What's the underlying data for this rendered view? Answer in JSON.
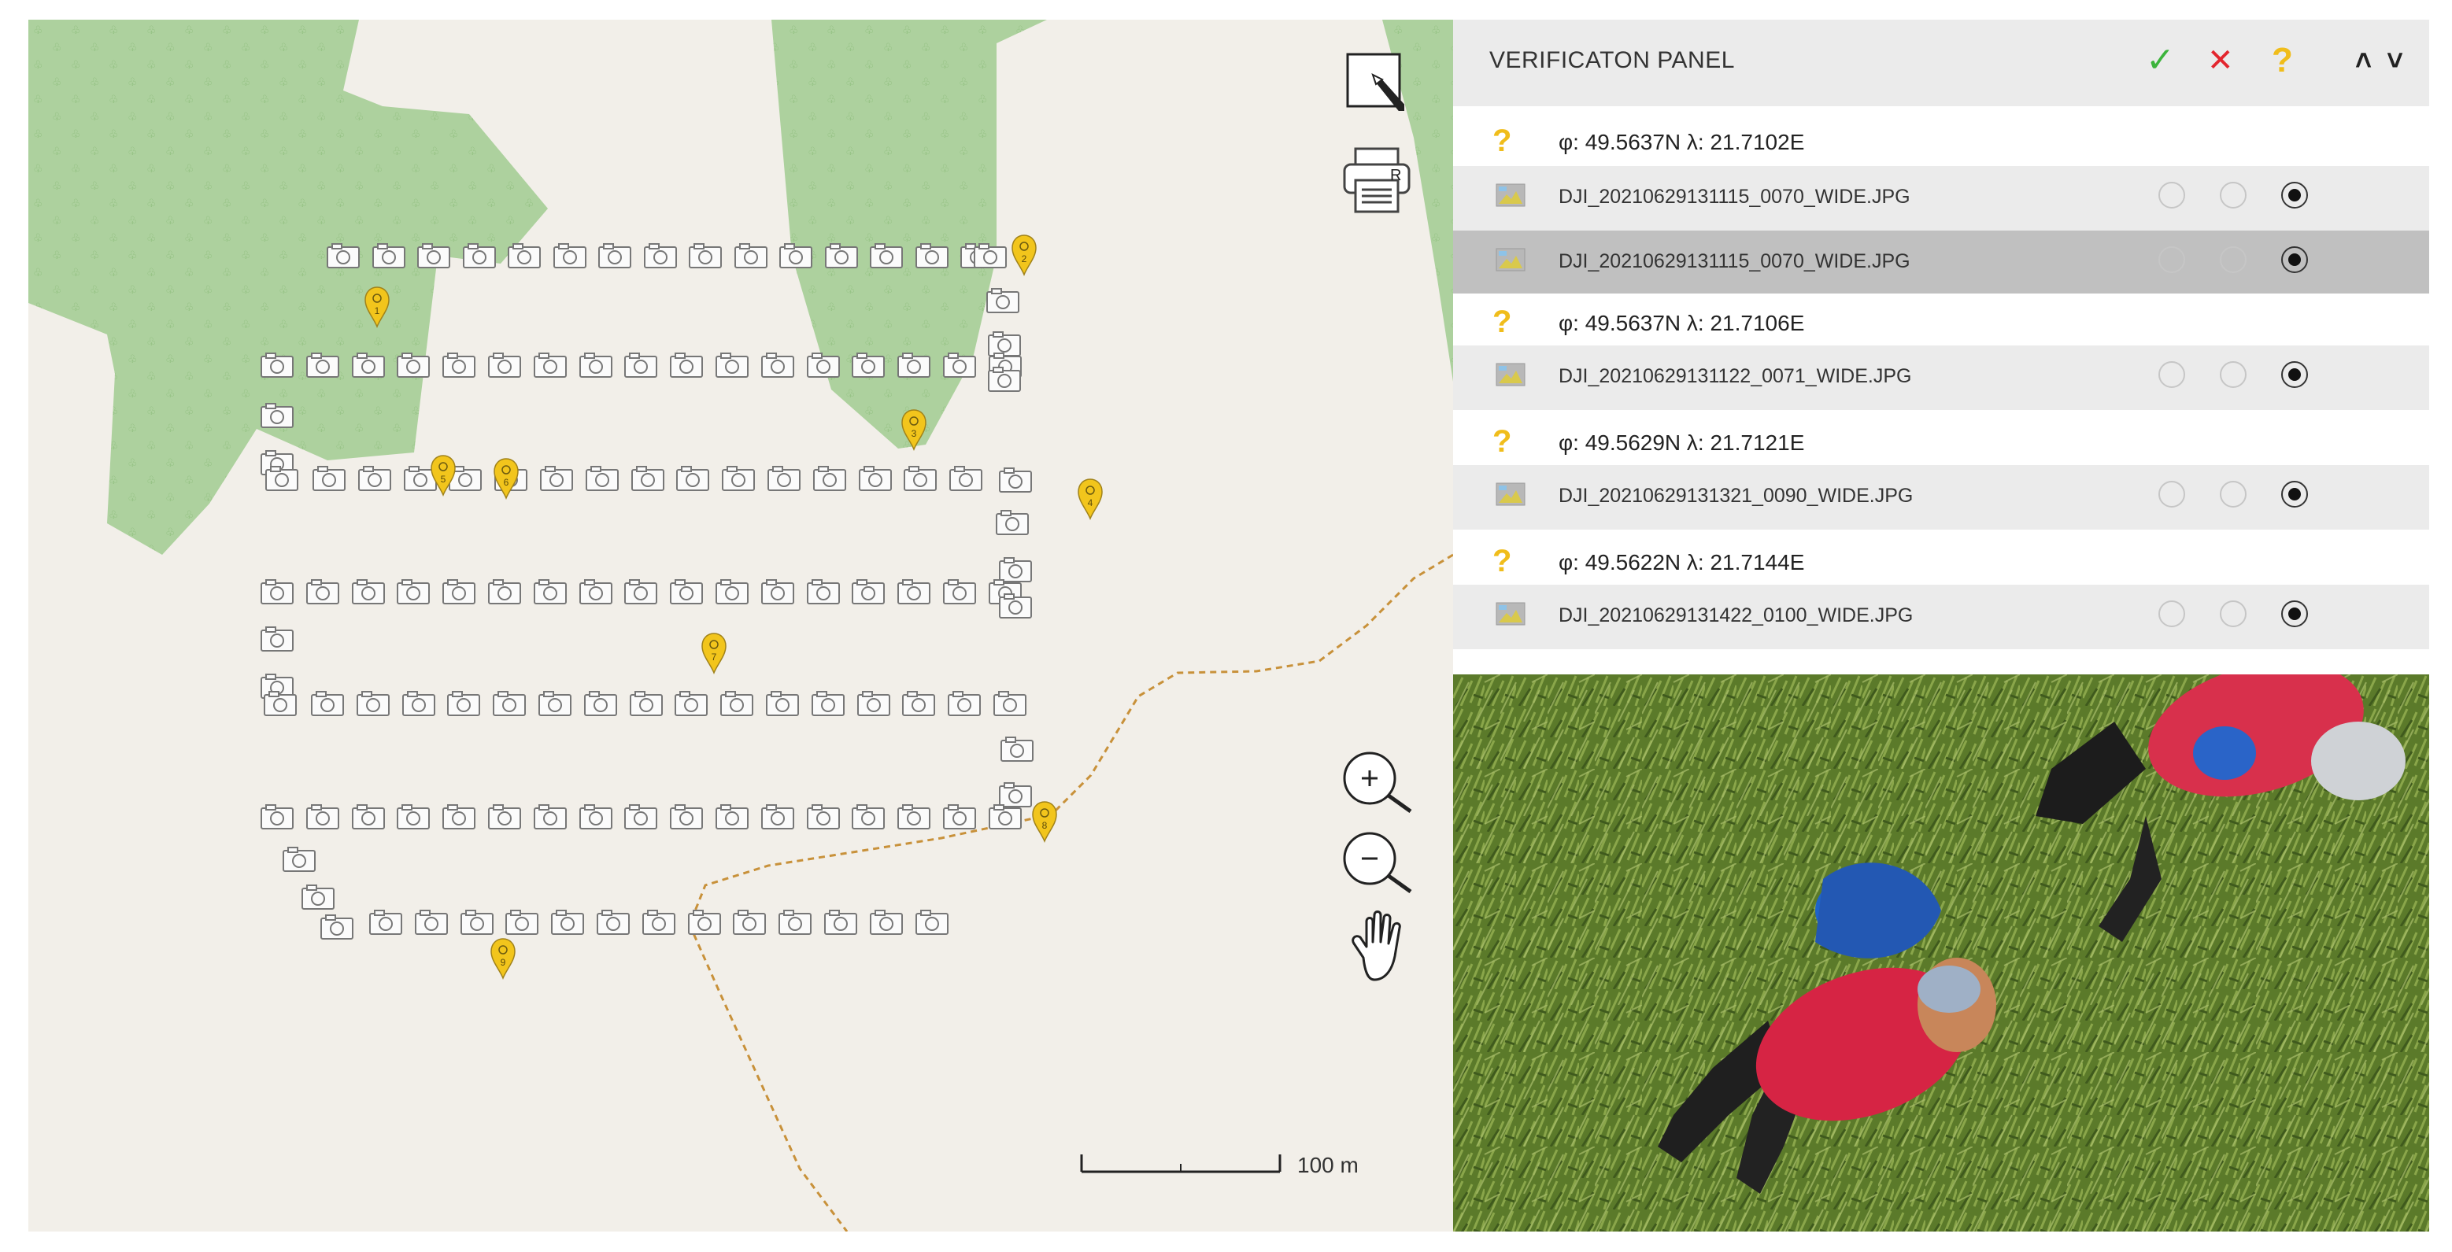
{
  "panel": {
    "title": "VERIFICATON PANEL",
    "accept_symbol": "✓",
    "reject_symbol": "✕",
    "unknown_symbol": "?",
    "up_symbol": "˄",
    "down_symbol": "˅",
    "colors": {
      "accept": "#3cb43c",
      "reject": "#e3262e",
      "unknown": "#f0bd1b"
    }
  },
  "rows": [
    {
      "type": "point",
      "text": "φ: 49.5637N λ: 21.7102E"
    },
    {
      "type": "image",
      "text": "DJI_20210629131115_0070_WIDE.JPG",
      "selected": false,
      "choice": 3
    },
    {
      "type": "image",
      "text": "DJI_20210629131115_0070_WIDE.JPG",
      "selected": true,
      "choice": 3
    },
    {
      "type": "point",
      "text": "φ: 49.5637N λ: 21.7106E"
    },
    {
      "type": "image",
      "text": "DJI_20210629131122_0071_WIDE.JPG",
      "selected": false,
      "choice": 3
    },
    {
      "type": "point",
      "text": "φ: 49.5629N λ: 21.7121E"
    },
    {
      "type": "image",
      "text": "DJI_20210629131321_0090_WIDE.JPG",
      "selected": false,
      "choice": 3
    },
    {
      "type": "point",
      "text": "φ: 49.5622N λ: 21.7144E"
    },
    {
      "type": "image",
      "text": "DJI_20210629131422_0100_WIDE.JPG",
      "selected": false,
      "choice": 3
    }
  ],
  "map": {
    "scale_label": "100 m",
    "printer_label": "R",
    "pin_labels": [
      "1",
      "2",
      "3",
      "4",
      "5",
      "6",
      "7",
      "8",
      "9"
    ],
    "colors": {
      "land": "#f2efe9",
      "forest": "#add19e",
      "path": "#c8913a",
      "pin": "#f2c51c"
    }
  },
  "photo": {
    "description_icon": "drone-photo"
  }
}
